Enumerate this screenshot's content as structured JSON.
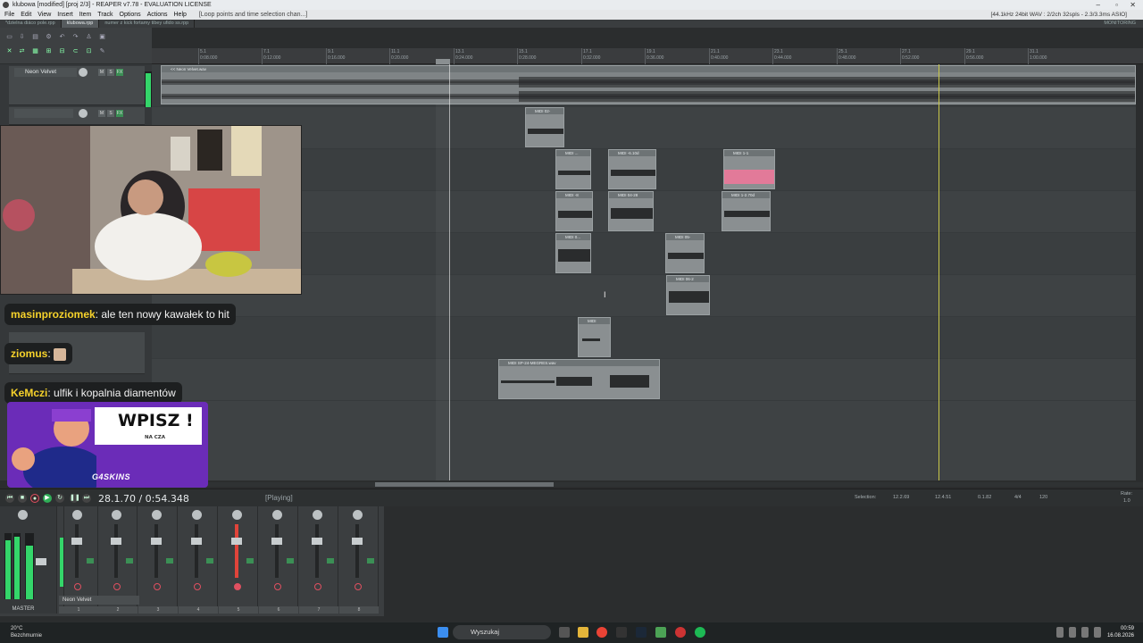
{
  "window": {
    "title": "klubowa [modified] [proj 2/3] - REAPER v7.78 - EVALUATION LICENSE",
    "format_status": "[44.1kHz 24bit WAV : 2/2ch 32spls - 2.3/3.3ms ASIO]"
  },
  "menu": {
    "items": [
      "File",
      "Edit",
      "View",
      "Insert",
      "Item",
      "Track",
      "Options",
      "Actions",
      "Help"
    ],
    "hint": "[Loop points and time selection chan...]"
  },
  "tabs": {
    "items": [
      "*dzielna diáco pole.rpp",
      "klubowa.rpp",
      "numer z kick fortamy tibey ufido ss.rpp"
    ],
    "right": "MONITORING"
  },
  "ruler": {
    "marks": [
      {
        "bar": "5.1",
        "time": "0:08.000"
      },
      {
        "bar": "7.1",
        "time": "0:12.000"
      },
      {
        "bar": "9.1",
        "time": "0:16.000"
      },
      {
        "bar": "11.1",
        "time": "0:20.000"
      },
      {
        "bar": "13.1",
        "time": "0:24.000"
      },
      {
        "bar": "15.1",
        "time": "0:28.000"
      },
      {
        "bar": "17.1",
        "time": "0:32.000"
      },
      {
        "bar": "19.1",
        "time": "0:36.000"
      },
      {
        "bar": "21.1",
        "time": "0:40.000"
      },
      {
        "bar": "23.1",
        "time": "0:44.000"
      },
      {
        "bar": "25.1",
        "time": "0:48.000"
      },
      {
        "bar": "27.1",
        "time": "0:52.000"
      },
      {
        "bar": "29.1",
        "time": "0:56.000"
      },
      {
        "bar": "31.1",
        "time": "1:00.000"
      }
    ]
  },
  "tracks": {
    "first_name": "Neon Velvet",
    "button_labels": {
      "m": "M",
      "s": "S",
      "fx": "FX"
    }
  },
  "items": {
    "main_wave": "<< Neon Velvet.wav",
    "labels": [
      "MIDI 02-",
      "MIDI ...",
      "MIDI -6.10d",
      "MIDI 1-1",
      "MIDI -8",
      "MIDI 04-28",
      "MIDI 1-2.70d",
      "MIDI 0...",
      "MIDI 05-",
      "MIDI 06-2",
      "MIDI",
      "MIDI SP-24-MEGRES.wav"
    ]
  },
  "transport": {
    "time": "28.1.70 / 0:54.348",
    "state": "[Playing]",
    "selection_label": "Selection:",
    "sel_start": "12.2.69",
    "sel_end": "12.4.51",
    "sel_len": "0.1.82",
    "timesig": "4/4",
    "bpm": "120",
    "rate_label": "Rate:",
    "rate": "1.0"
  },
  "mixer": {
    "master_label": "MASTER",
    "strip1_name": "Neon Velvet",
    "channels": [
      "1",
      "2",
      "3",
      "4",
      "5",
      "6",
      "7",
      "8"
    ]
  },
  "overlay": {
    "chat": [
      {
        "user": "masinproziomek",
        "text": "ale ten nowy kawałek to hit"
      },
      {
        "user": "ziomus",
        "text": ""
      },
      {
        "user": "KeMczi",
        "text": "ulfik i kopalnia diamentów"
      }
    ],
    "promo_title": "WPISZ !",
    "promo_sub": "NA CZA",
    "promo_brand": "G4SKINS"
  },
  "taskbar": {
    "temp": "20°C",
    "weather": "Bezchmurnie",
    "search_placeholder": "Wyszukaj",
    "time": "00:59",
    "date": "16.08.2026"
  }
}
